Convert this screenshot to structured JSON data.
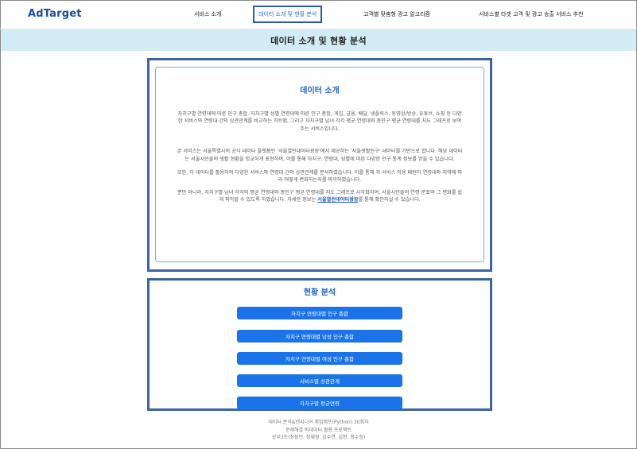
{
  "header": {
    "logo": "AdTarget",
    "nav": [
      {
        "label": "서비스 소개",
        "active": false
      },
      {
        "label": "데이터 소개 및 현황 분석",
        "active": true
      },
      {
        "label": "고객별 맞춤형 광고 알고리즘",
        "active": false
      },
      {
        "label": "서비스별 타겟 고객 및 광고 송출 서비스 추천",
        "active": false
      }
    ]
  },
  "page_title": "데이터 소개 및 현황 분석",
  "intro": {
    "heading": "데이터 소개",
    "p1": "자치구별 연령대에 따른 인구 총합, 자치구별 성별 연령대에 따른 인구 총합, 게임, 금융, 배달, 넷플릭스, 동영상/방송, 유튜브, 쇼핑 등 다양한 서비스와 연령대 간의 상관관계를 비교하는 히트맵, 그리고 자치구별 남녀 각각 평균 연령대와 총인구 평균 연령대를 지도 그래프로 보여주는 서비스입니다.",
    "p2": "본 서비스는 서울특별시의 공식 데이터 플랫폼인 '서울열린데이터광장'에서 제공하는 '서울생활인구' 데이터를 기반으로 합니다. 해당 데이터는 서울시민들의 생활 현황을 정교하게 표현하며, 이를 통해 자치구, 연령대, 성별에 따른 다양한 인구 통계 정보를 얻을 수 있습니다.",
    "p3": "또한, 이 데이터를 활용하여 다양한 서비스와 연령대 간의 상관관계를 분석하였습니다. 이를 통해 각 서비스 이용 패턴이 연령대와 지역에 따라 어떻게 변화하는지를 파악하였습니다.",
    "p4_before": "뿐만 아니라, 자치구별 남녀 각각의 평균 연령대와 총인구 평균 연령대를 지도 그래프로 시각화하여, 서울시민들의 연령 분포와 그 변화를 쉽게 파악할 수 있도록 하였습니다. 자세한 정보는 ",
    "p4_link": "서울열린데이터광장",
    "p4_after": "를 통해 확인하실 수 있습니다."
  },
  "status": {
    "heading": "현황 분석",
    "buttons": [
      "자치구 연령대별 인구 총합",
      "자치구 연령대별 남성 인구 총합",
      "자치구 연령대별 여성 인구 총합",
      "서비스별 상관관계",
      "자치구별 평균연령"
    ]
  },
  "footer": {
    "line1": "데이터 분석&엔지니어 취업캠프(Python) 30회차",
    "line2": "문제해결 빅데이터 활용 프로젝트",
    "line3": "상부3조(최정민, 정재원, 김수연, 김현, 최수정)"
  },
  "colors": {
    "accent": "#1a73e8",
    "logo": "#1f4e9e",
    "title_bar": "#d2ecf5",
    "section_border": "#3d63a5"
  }
}
